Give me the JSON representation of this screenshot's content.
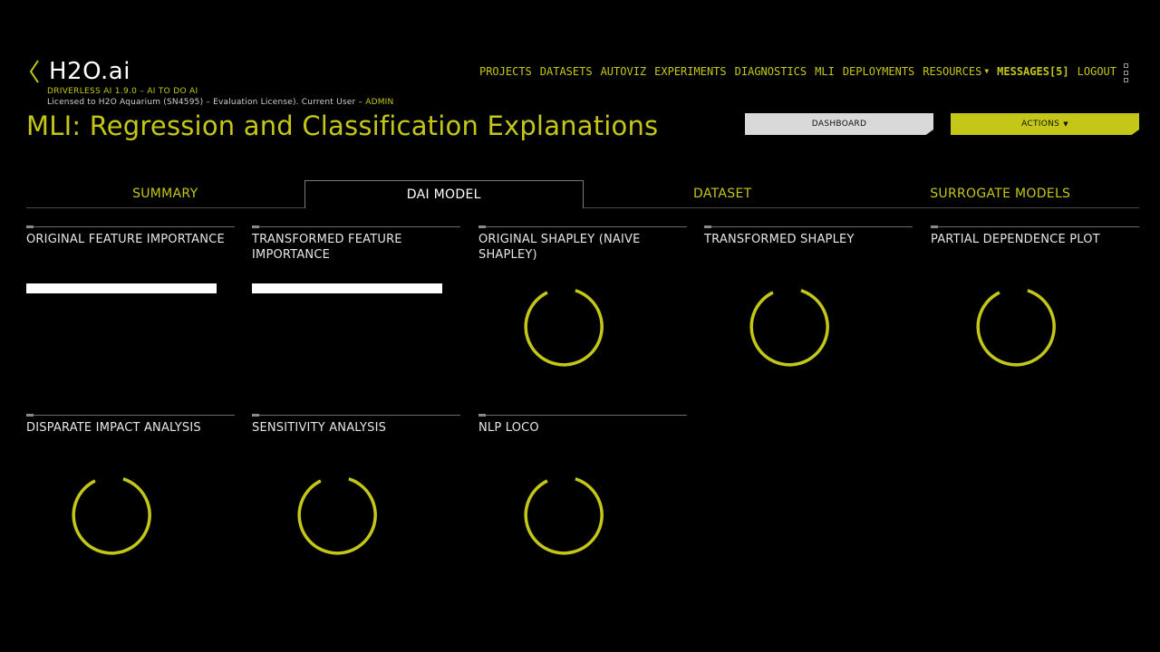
{
  "header": {
    "logo": "H2O.ai",
    "version": "DRIVERLESS AI 1.9.0 – AI TO DO AI",
    "license": "Licensed to H2O Aquarium (SN4595) – Evaluation License). Current User – ",
    "user": "ADMIN"
  },
  "nav": {
    "items": [
      "PROJECTS",
      "DATASETS",
      "AUTOVIZ",
      "EXPERIMENTS",
      "DIAGNOSTICS",
      "MLI",
      "DEPLOYMENTS",
      "RESOURCES",
      "MESSAGES[5]",
      "LOGOUT"
    ]
  },
  "page": {
    "title": "MLI: Regression and Classification Explanations",
    "dashboard_label": "DASHBOARD",
    "actions_label": "ACTIONS"
  },
  "tabs": [
    "SUMMARY",
    "DAI MODEL",
    "DATASET",
    "SURROGATE MODELS"
  ],
  "cards": [
    "ORIGINAL FEATURE IMPORTANCE",
    "TRANSFORMED FEATURE IMPORTANCE",
    "ORIGINAL SHAPLEY (NAIVE SHAPLEY)",
    "TRANSFORMED SHAPLEY",
    "PARTIAL DEPENDENCE PLOT",
    "DISPARATE IMPACT ANALYSIS",
    "SENSITIVITY ANALYSIS",
    "NLP LOCO"
  ],
  "colors": {
    "accent": "#c5c718",
    "background": "#000000",
    "text": "#e6e6e6"
  }
}
